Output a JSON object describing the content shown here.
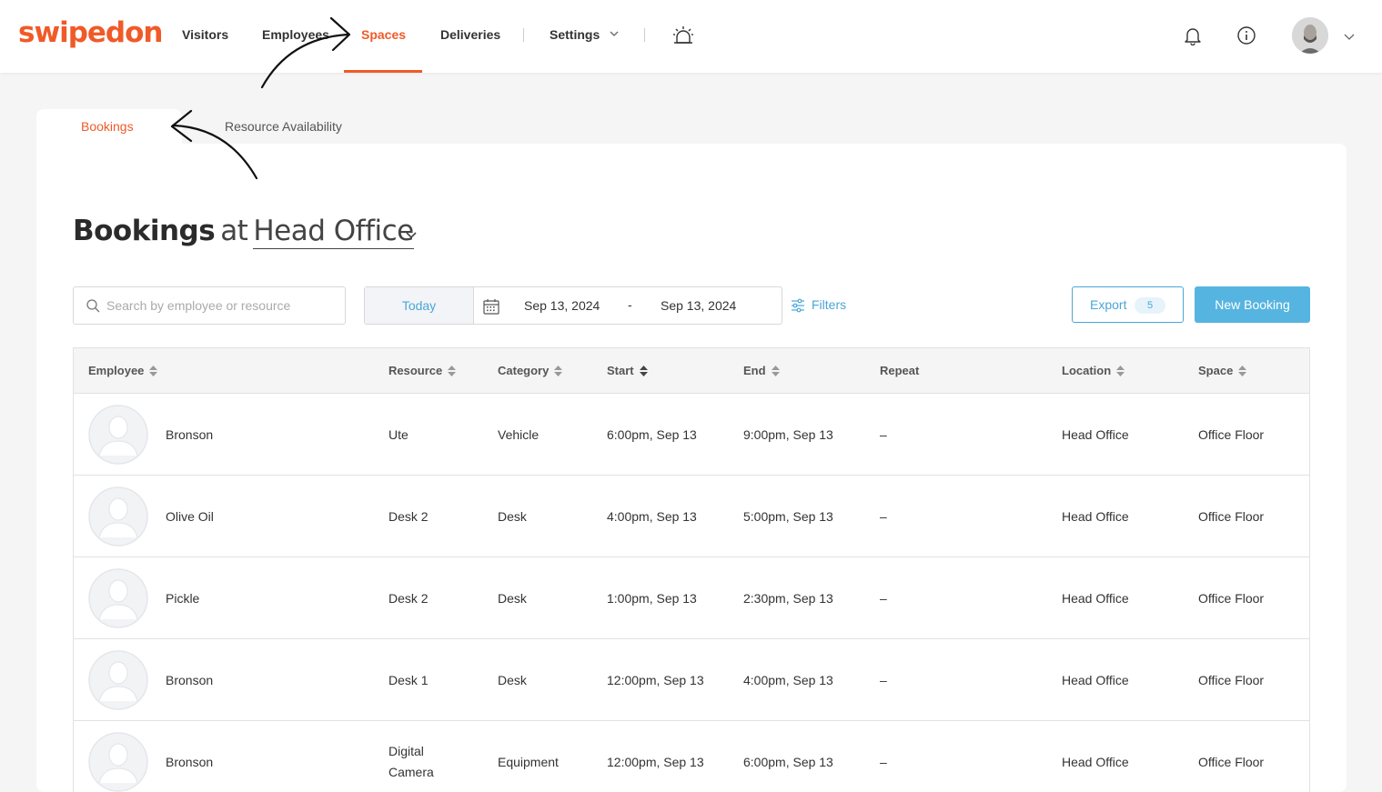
{
  "brand": {
    "logo_text": "swipedon",
    "accent": "#f05a28",
    "link": "#4aa6d8"
  },
  "nav": {
    "items": [
      "Visitors",
      "Employees",
      "Spaces",
      "Deliveries",
      "Settings"
    ],
    "active": "Spaces",
    "icons": [
      "evacuation-alarm-icon",
      "bell-icon",
      "info-icon",
      "avatar",
      "chevron-down-icon"
    ]
  },
  "subtabs": {
    "items": [
      "Bookings",
      "Resource Availability"
    ],
    "active": "Bookings"
  },
  "heading": {
    "title": "Bookings",
    "at": "at",
    "location": "Head Office"
  },
  "controls": {
    "search_placeholder": "Search by employee or resource",
    "today_label": "Today",
    "date_start": "Sep 13, 2024",
    "date_separator": "-",
    "date_end": "Sep 13, 2024",
    "filters_label": "Filters",
    "export_label": "Export",
    "export_count": "5",
    "new_booking_label": "New Booking"
  },
  "table": {
    "columns": [
      "Employee",
      "Resource",
      "Category",
      "Start",
      "End",
      "Repeat",
      "Location",
      "Space"
    ],
    "rows": [
      [
        "Bronson",
        "Ute",
        "Vehicle",
        "6:00pm, Sep 13",
        "9:00pm, Sep 13",
        "–",
        "Head Office",
        "Office Floor"
      ],
      [
        "Olive Oil",
        "Desk 2",
        "Desk",
        "4:00pm, Sep 13",
        "5:00pm, Sep 13",
        "–",
        "Head Office",
        "Office Floor"
      ],
      [
        "Pickle",
        "Desk 2",
        "Desk",
        "1:00pm, Sep 13",
        "2:30pm, Sep 13",
        "–",
        "Head Office",
        "Office Floor"
      ],
      [
        "Bronson",
        "Desk 1",
        "Desk",
        "12:00pm, Sep 13",
        "4:00pm, Sep 13",
        "–",
        "Head Office",
        "Office Floor"
      ],
      [
        "Bronson",
        "Digital Camera",
        "Equipment",
        "12:00pm, Sep 13",
        "6:00pm, Sep 13",
        "–",
        "Head Office",
        "Office Floor"
      ]
    ]
  }
}
